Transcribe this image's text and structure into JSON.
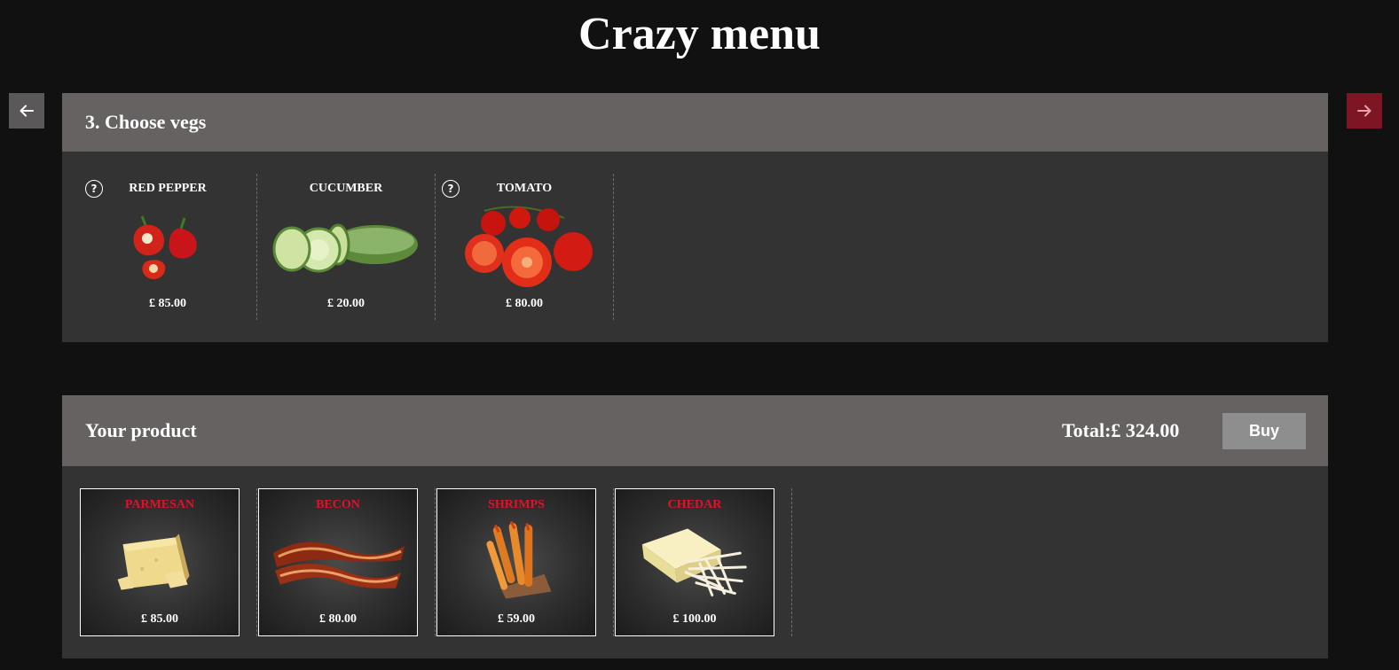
{
  "page_title": "Crazy menu",
  "nav": {
    "prev_icon": "arrow-left-icon",
    "next_icon": "arrow-right-icon"
  },
  "step": {
    "title": "3. Choose vegs",
    "items": [
      {
        "name": "RED PEPPER",
        "price": "£ 85.00",
        "has_help": true,
        "help_glyph": "?"
      },
      {
        "name": "CUCUMBER",
        "price": "£ 20.00",
        "has_help": false
      },
      {
        "name": "TOMATO",
        "price": "£ 80.00",
        "has_help": true,
        "help_glyph": "?"
      }
    ]
  },
  "product": {
    "title": "Your product",
    "total": "Total:£ 324.00",
    "buy_label": "Buy",
    "items": [
      {
        "name": "PARMESAN",
        "price": "£ 85.00"
      },
      {
        "name": "BECON",
        "price": "£ 80.00"
      },
      {
        "name": "SHRIMPS",
        "price": "£ 59.00"
      },
      {
        "name": "CHEDAR",
        "price": "£ 100.00"
      }
    ]
  },
  "colors": {
    "background": "#111111",
    "panel": "#333333",
    "panel_header": "#666261",
    "next_button": "#7d1622",
    "prev_button": "#5a5858",
    "product_name": "#e0122b",
    "buy_button": "#8e8e8e"
  }
}
